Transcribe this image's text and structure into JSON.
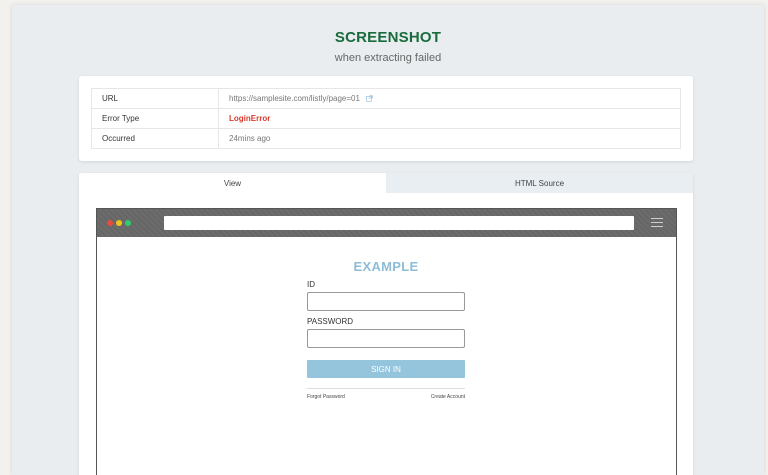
{
  "header": {
    "title": "SCREENSHOT",
    "subtitle": "when extracting failed"
  },
  "info": {
    "rows": [
      {
        "label": "URL",
        "value": "https://samplesite.com/listly/page=01"
      },
      {
        "label": "Error Type",
        "value": "LoginError"
      },
      {
        "label": "Occurred",
        "value": "24mins ago"
      }
    ]
  },
  "tabs": [
    {
      "label": "View",
      "active": true
    },
    {
      "label": "HTML Source",
      "active": false
    }
  ],
  "mockup": {
    "brand": "EXAMPLE",
    "id_label": "ID",
    "password_label": "PASSWORD",
    "signin_label": "SIGN IN",
    "forgot_label": "Forgot Password",
    "create_label": "Create Account"
  },
  "colors": {
    "title": "#1a6b3c",
    "error": "#d93a2e",
    "accent": "#94c5dc",
    "brand": "#8fbdd6"
  },
  "icons": {
    "external_link": "external-link-icon",
    "menu": "hamburger-menu-icon"
  }
}
